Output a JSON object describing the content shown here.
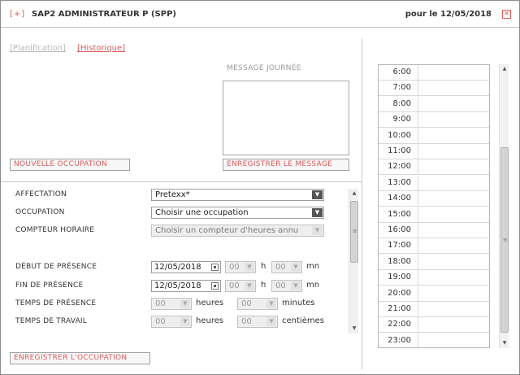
{
  "window": {
    "plus": "[+]",
    "title": "SAP2 ADMINISTRATEUR P (SPP)",
    "date_label": "pour le 12/05/2018",
    "close": "×"
  },
  "tabs": {
    "planification": "[Planification]",
    "historique": "[Historique]"
  },
  "message": {
    "label": "MESSAGE JOURNÉE",
    "value": "",
    "save_button": "ENREGISTRER LE MESSAGE"
  },
  "buttons": {
    "new_occupation": "NOUVELLE OCCUPATION",
    "save_occupation": "ENREGISTRER L'OCCUPATION"
  },
  "form": {
    "affectation": {
      "label": "AFFECTATION",
      "value": "Pretexx*"
    },
    "occupation": {
      "label": "OCCUPATION",
      "value": "Choisir une occupation"
    },
    "compteur": {
      "label": "COMPTEUR HORAIRE",
      "value": "Choisir un compteur d'heures annu"
    },
    "debut": {
      "label": "DÉBUT DE PRÉSENCE",
      "date": "12/05/2018",
      "hour": "00",
      "h_unit": "h",
      "minute": "00",
      "mn_unit": "mn"
    },
    "fin": {
      "label": "FIN DE PRÉSENCE",
      "date": "12/05/2018",
      "hour": "00",
      "h_unit": "h",
      "minute": "00",
      "mn_unit": "mn"
    },
    "temps_presence": {
      "label": "TEMPS DE PRÉSENCE",
      "hours": "00",
      "hours_unit": "heures",
      "minutes": "00",
      "minutes_unit": "minutes"
    },
    "temps_travail": {
      "label": "TEMPS DE TRAVAIL",
      "hours": "00",
      "hours_unit": "heures",
      "cent": "00",
      "cent_unit": "centièmes"
    }
  },
  "schedule": {
    "hours": [
      "6:00",
      "7:00",
      "8:00",
      "9:00",
      "10:00",
      "11:00",
      "12:00",
      "13:00",
      "14:00",
      "15:00",
      "16:00",
      "17:00",
      "18:00",
      "19:00",
      "20:00",
      "21:00",
      "22:00",
      "23:00"
    ]
  },
  "colors": {
    "accent": "#d95b5b",
    "muted_link": "#b9b9b9"
  }
}
